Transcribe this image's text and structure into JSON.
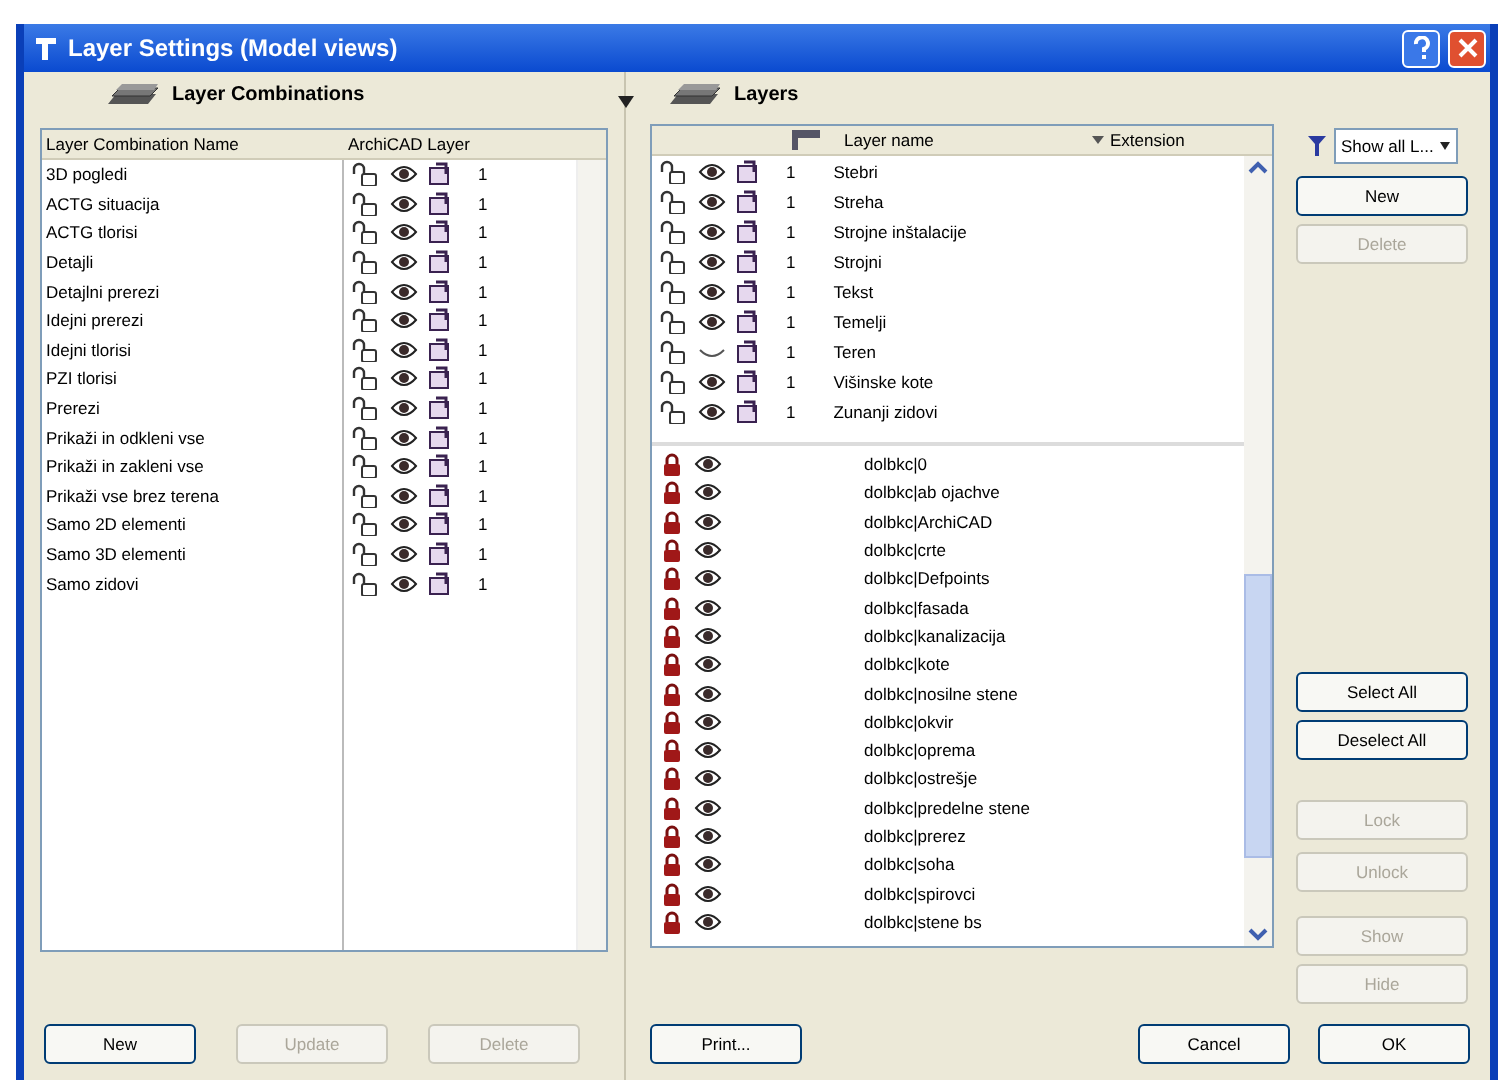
{
  "window": {
    "title": "Layer Settings (Model views)"
  },
  "left_panel": {
    "title": "Layer Combinations",
    "columns": [
      "Layer Combination Name",
      "ArchiCAD Layer"
    ],
    "rows": [
      {
        "name": "3D pogledi",
        "locked": false,
        "visible": true,
        "value": "1"
      },
      {
        "name": "ACTG situacija",
        "locked": false,
        "visible": true,
        "value": "1"
      },
      {
        "name": "ACTG tlorisi",
        "locked": false,
        "visible": true,
        "value": "1"
      },
      {
        "name": "Detajli",
        "locked": false,
        "visible": true,
        "value": "1"
      },
      {
        "name": "Detajlni prerezi",
        "locked": false,
        "visible": true,
        "value": "1"
      },
      {
        "name": "Idejni prerezi",
        "locked": false,
        "visible": true,
        "value": "1"
      },
      {
        "name": "Idejni tlorisi",
        "locked": false,
        "visible": true,
        "value": "1"
      },
      {
        "name": "PZI tlorisi",
        "locked": false,
        "visible": true,
        "value": "1"
      },
      {
        "name": "Prerezi",
        "locked": false,
        "visible": true,
        "value": "1"
      },
      {
        "name": "Prikaži in odkleni vse",
        "locked": false,
        "visible": true,
        "value": "1"
      },
      {
        "name": "Prikaži in zakleni vse",
        "locked": false,
        "visible": true,
        "value": "1"
      },
      {
        "name": "Prikaži vse brez terena",
        "locked": false,
        "visible": true,
        "value": "1"
      },
      {
        "name": "Samo 2D elementi",
        "locked": false,
        "visible": true,
        "value": "1"
      },
      {
        "name": "Samo 3D elementi",
        "locked": false,
        "visible": true,
        "value": "1"
      },
      {
        "name": "Samo zidovi",
        "locked": false,
        "visible": true,
        "value": "1"
      }
    ],
    "buttons": [
      {
        "label": "New",
        "disabled": false
      },
      {
        "label": "Update",
        "disabled": true
      },
      {
        "label": "Delete",
        "disabled": true
      }
    ]
  },
  "right_panel": {
    "title": "Layers",
    "columns": [
      "Layer name",
      "Extension"
    ],
    "layers": [
      {
        "name": "Stebri",
        "locked": false,
        "visible": true,
        "value": "1"
      },
      {
        "name": "Streha",
        "locked": false,
        "visible": true,
        "value": "1"
      },
      {
        "name": "Strojne inštalacije",
        "locked": false,
        "visible": true,
        "value": "1"
      },
      {
        "name": "Strojni",
        "locked": false,
        "visible": true,
        "value": "1"
      },
      {
        "name": "Tekst",
        "locked": false,
        "visible": true,
        "value": "1"
      },
      {
        "name": "Temelji",
        "locked": false,
        "visible": true,
        "value": "1"
      },
      {
        "name": "Teren",
        "locked": false,
        "visible": false,
        "value": "1"
      },
      {
        "name": "Višinske kote",
        "locked": false,
        "visible": true,
        "value": "1"
      },
      {
        "name": "Zunanji zidovi",
        "locked": false,
        "visible": true,
        "value": "1"
      }
    ],
    "xref_layers": [
      {
        "name": "dolbkc|0",
        "locked": true,
        "visible": true
      },
      {
        "name": "dolbkc|ab ojachve",
        "locked": true,
        "visible": true
      },
      {
        "name": "dolbkc|ArchiCAD",
        "locked": true,
        "visible": true
      },
      {
        "name": "dolbkc|crte",
        "locked": true,
        "visible": true
      },
      {
        "name": "dolbkc|Defpoints",
        "locked": true,
        "visible": true
      },
      {
        "name": "dolbkc|fasada",
        "locked": true,
        "visible": true
      },
      {
        "name": "dolbkc|kanalizacija",
        "locked": true,
        "visible": true
      },
      {
        "name": "dolbkc|kote",
        "locked": true,
        "visible": true
      },
      {
        "name": "dolbkc|nosilne stene",
        "locked": true,
        "visible": true
      },
      {
        "name": "dolbkc|okvir",
        "locked": true,
        "visible": true
      },
      {
        "name": "dolbkc|oprema",
        "locked": true,
        "visible": true
      },
      {
        "name": "dolbkc|ostrešje",
        "locked": true,
        "visible": true
      },
      {
        "name": "dolbkc|predelne stene",
        "locked": true,
        "visible": true
      },
      {
        "name": "dolbkc|prerez",
        "locked": true,
        "visible": true
      },
      {
        "name": "dolbkc|soha",
        "locked": true,
        "visible": true
      },
      {
        "name": "dolbkc|spirovci",
        "locked": true,
        "visible": true
      },
      {
        "name": "dolbkc|stene bs",
        "locked": true,
        "visible": true
      }
    ],
    "filter": {
      "value": "Show all L..."
    },
    "side_buttons": [
      {
        "label": "New",
        "disabled": false
      },
      {
        "label": "Delete",
        "disabled": true
      }
    ],
    "select_buttons": [
      {
        "label": "Select All",
        "disabled": false
      },
      {
        "label": "Deselect All",
        "disabled": false
      }
    ],
    "lock_buttons": [
      {
        "label": "Lock",
        "disabled": true
      },
      {
        "label": "Unlock",
        "disabled": true
      }
    ],
    "show_buttons": [
      {
        "label": "Show",
        "disabled": true
      },
      {
        "label": "Hide",
        "disabled": true
      }
    ]
  },
  "footer": {
    "print": {
      "label": "Print...",
      "disabled": false
    },
    "buttons": [
      {
        "label": "Cancel",
        "disabled": false
      },
      {
        "label": "OK",
        "disabled": false
      }
    ]
  }
}
